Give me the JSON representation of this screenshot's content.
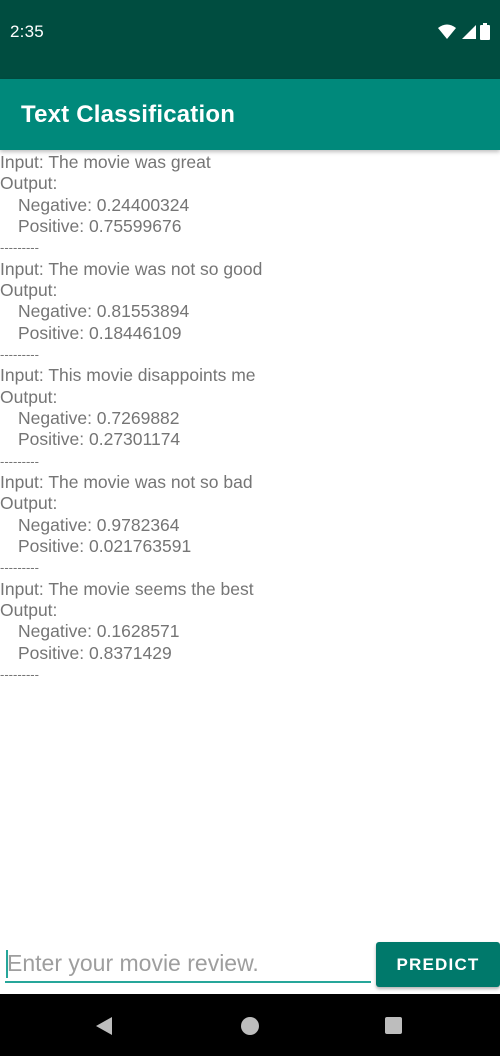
{
  "status_bar": {
    "time": "2:35",
    "icons": [
      "wifi-icon",
      "signal-icon",
      "battery-icon"
    ]
  },
  "app_bar": {
    "title": "Text Classification"
  },
  "results": [
    {
      "input": "Input: The movie was great",
      "output_label": "Output:",
      "negative": "Negative: 0.24400324",
      "positive": "Positive: 0.75599676",
      "separator": "---------"
    },
    {
      "input": "Input: The movie was not so good",
      "output_label": "Output:",
      "negative": "Negative: 0.81553894",
      "positive": "Positive: 0.18446109",
      "separator": "---------"
    },
    {
      "input": "Input: This movie disappoints me",
      "output_label": "Output:",
      "negative": "Negative: 0.7269882",
      "positive": "Positive: 0.27301174",
      "separator": "---------"
    },
    {
      "input": "Input: The movie was not so bad",
      "output_label": "Output:",
      "negative": "Negative: 0.9782364",
      "positive": "Positive: 0.021763591",
      "separator": "---------"
    },
    {
      "input": "Input: The movie seems the best",
      "output_label": "Output:",
      "negative": "Negative: 0.1628571",
      "positive": "Positive: 0.8371429",
      "separator": "---------"
    }
  ],
  "review_input": {
    "value": "",
    "placeholder": "Enter your movie review."
  },
  "predict_button": {
    "label": "PREDICT"
  },
  "nav_bar": {
    "icons": [
      "back-icon",
      "home-icon",
      "recents-icon"
    ]
  },
  "colors": {
    "status_bar": "#004d40",
    "app_bar": "#00897b",
    "accent": "#26a69a",
    "button": "#00796b"
  }
}
